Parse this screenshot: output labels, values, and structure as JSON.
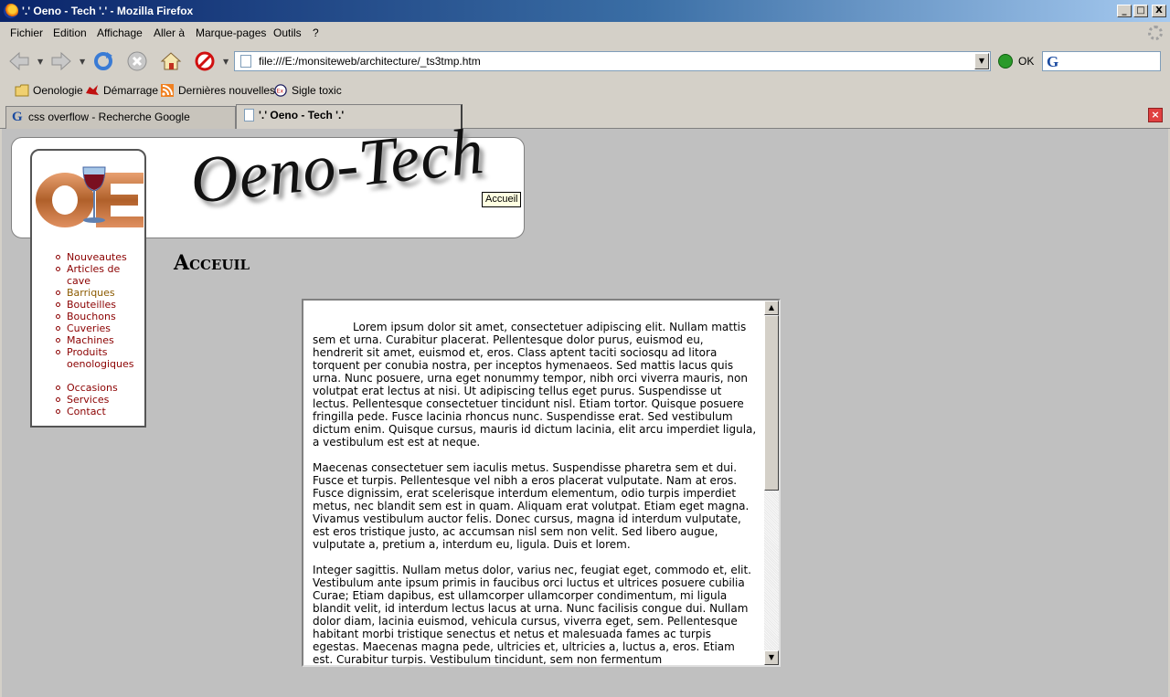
{
  "window": {
    "title": "'.' Oeno - Tech '.' - Mozilla Firefox",
    "controls": {
      "minimize": "_",
      "maximize": "□",
      "close": "X"
    }
  },
  "menubar": {
    "items": [
      "Fichier",
      "Edition",
      "Affichage",
      "Aller à",
      "Marque-pages",
      "Outils",
      "?"
    ]
  },
  "navbar": {
    "url": "file:///E:/monsiteweb/architecture/_ts3tmp.htm",
    "go_label": "OK",
    "search_value": ""
  },
  "bookmarks": {
    "items": [
      "Oenologie",
      "Démarrage",
      "Dernières nouvelles",
      "Sigle toxic"
    ]
  },
  "tabs": {
    "items": [
      {
        "label": "css overflow - Recherche Google",
        "active": false
      },
      {
        "label": "'.' Oeno - Tech '.'",
        "active": true
      }
    ]
  },
  "page": {
    "banner_title": "Oeno-Tech",
    "tooltip": "Accueil",
    "heading": "Acceuil",
    "menu": {
      "group1": [
        "Nouveautes",
        "Articles de cave",
        "Barriques",
        "Bouteilles",
        "Bouchons",
        "Cuveries",
        "Machines",
        "Produits oenologiques"
      ],
      "group2": [
        "Occasions",
        "Services",
        "Contact"
      ]
    },
    "paragraphs": [
      "Lorem ipsum dolor sit amet, consectetuer adipiscing elit. Nullam mattis sem et urna. Curabitur placerat. Pellentesque dolor purus, euismod eu, hendrerit sit amet, euismod et, eros. Class aptent taciti sociosqu ad litora torquent per conubia nostra, per inceptos hymenaeos. Sed mattis lacus quis urna. Nunc posuere, urna eget nonummy tempor, nibh orci viverra mauris, non volutpat erat lectus at nisi. Ut adipiscing tellus eget purus. Suspendisse ut lectus. Pellentesque consectetuer tincidunt nisl. Etiam tortor. Quisque posuere fringilla pede. Fusce lacinia rhoncus nunc. Suspendisse erat. Sed vestibulum dictum enim. Quisque cursus, mauris id dictum lacinia, elit arcu imperdiet ligula, a vestibulum est est at neque.",
      "Maecenas consectetuer sem iaculis metus. Suspendisse pharetra sem et dui. Fusce et turpis. Pellentesque vel nibh a eros placerat vulputate. Nam at eros. Fusce dignissim, erat scelerisque interdum elementum, odio turpis imperdiet metus, nec blandit sem est in quam. Aliquam erat volutpat. Etiam eget magna. Vivamus vestibulum auctor felis. Donec cursus, magna id interdum vulputate, est eros tristique justo, ac accumsan nisl sem non velit. Sed libero augue, vulputate a, pretium a, interdum eu, ligula. Duis et lorem.",
      "Integer sagittis. Nullam metus dolor, varius nec, feugiat eget, commodo et, elit. Vestibulum ante ipsum primis in faucibus orci luctus et ultrices posuere cubilia Curae; Etiam dapibus, est ullamcorper ullamcorper condimentum, mi ligula blandit velit, id interdum lectus lacus at urna. Nunc facilisis congue dui. Nullam dolor diam, lacinia euismod, vehicula cursus, viverra eget, sem. Pellentesque habitant morbi tristique senectus et netus et malesuada fames ac turpis egestas. Maecenas magna pede, ultricies et, ultricies a, luctus a, eros. Etiam est. Curabitur turpis. Vestibulum tincidunt, sem non fermentum"
    ]
  }
}
